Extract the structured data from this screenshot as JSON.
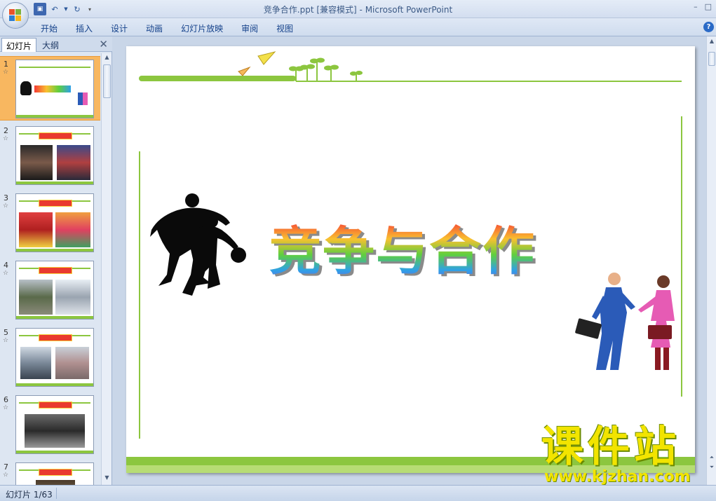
{
  "window": {
    "title": "竞争合作.ppt [兼容模式] - Microsoft PowerPoint",
    "controls": [
      "–",
      "□"
    ]
  },
  "ribbon": {
    "tabs": [
      "开始",
      "插入",
      "设计",
      "动画",
      "幻灯片放映",
      "审阅",
      "视图"
    ],
    "help": "?"
  },
  "left_pane": {
    "tabs": {
      "slides": "幻灯片",
      "outline": "大纲"
    },
    "close": "✕",
    "thumbnails": [
      {
        "num": "1",
        "star": "☆"
      },
      {
        "num": "2",
        "star": "☆"
      },
      {
        "num": "3",
        "star": "☆"
      },
      {
        "num": "4",
        "star": "☆"
      },
      {
        "num": "5",
        "star": "☆"
      },
      {
        "num": "6",
        "star": "☆"
      },
      {
        "num": "7",
        "star": "☆"
      }
    ]
  },
  "slide": {
    "title": "竞争与合作"
  },
  "watermark": {
    "name": "课件站",
    "url": "www.kjzhan.com"
  },
  "status": {
    "text": "幻灯片 1/63"
  },
  "colors": {
    "accent_green": "#8cc63f",
    "selected_thumb": "#f8b760"
  }
}
